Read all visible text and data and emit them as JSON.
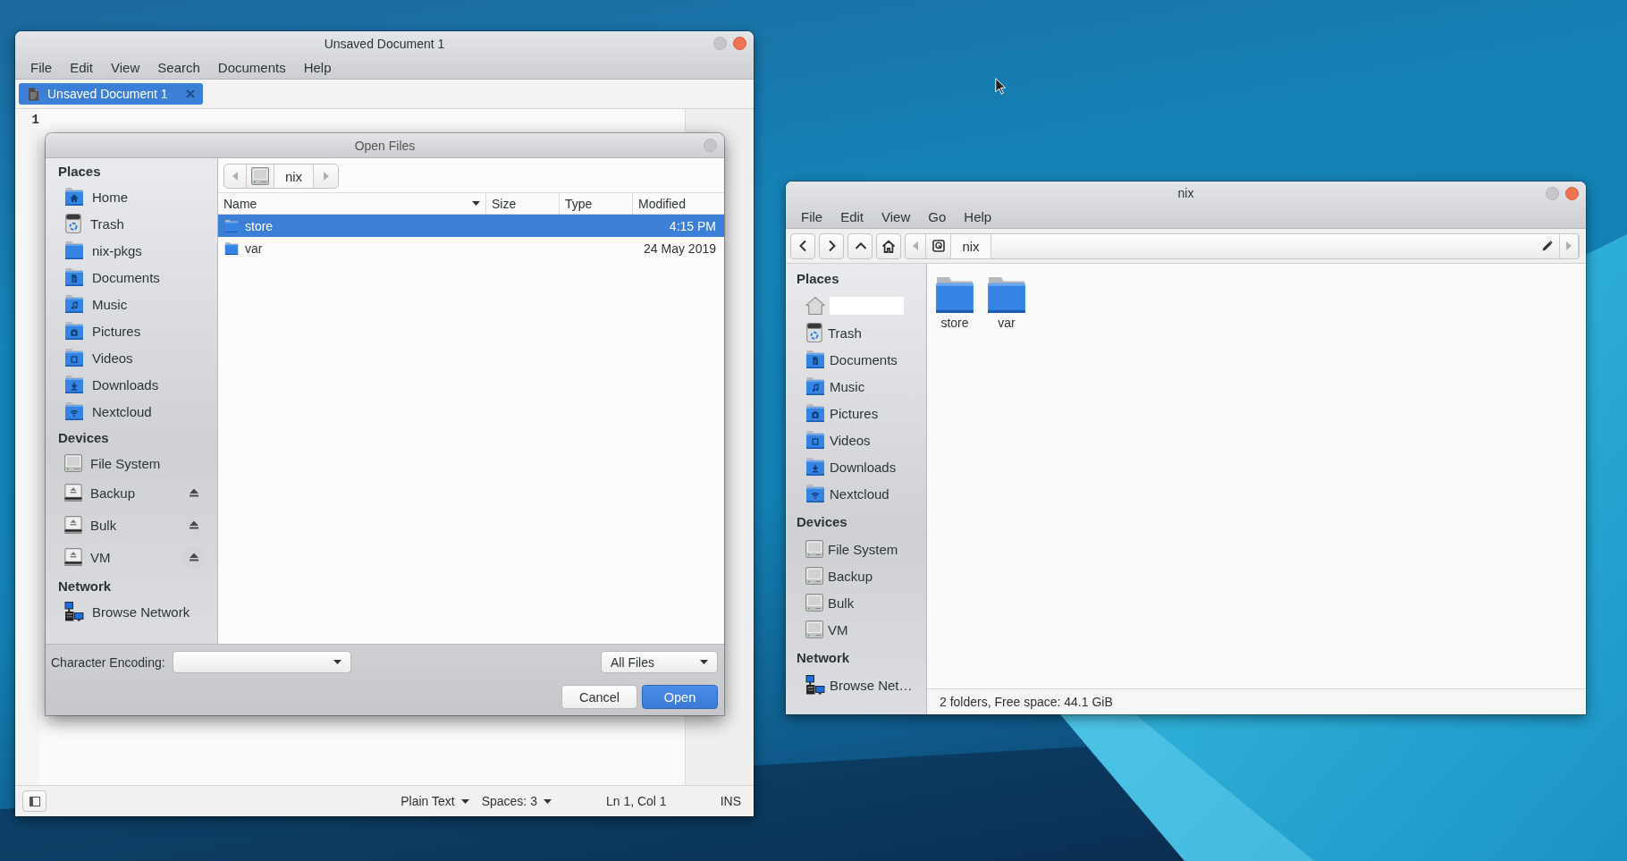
{
  "editor_window": {
    "title": "Unsaved Document 1",
    "menu": [
      "File",
      "Edit",
      "View",
      "Search",
      "Documents",
      "Help"
    ],
    "tabs": [
      {
        "label": "Unsaved Document 1",
        "selected": true
      }
    ],
    "line_numbers": [
      "1"
    ],
    "status_bar": [
      {
        "kind": "menu",
        "text": "Plain Text"
      },
      {
        "kind": "menu",
        "text": "Spaces: 3"
      },
      {
        "kind": "label",
        "text": "Ln 1, Col 1"
      },
      {
        "kind": "label",
        "text": "INS"
      }
    ]
  },
  "open_dialog": {
    "title": "Open Files",
    "sidebar": [
      {
        "heading": "Places",
        "items": [
          {
            "kind": "home",
            "label": "Home",
            "selected": false
          },
          {
            "kind": "trash",
            "label": "Trash",
            "selected": false
          },
          {
            "kind": "folder",
            "label": "nix-pkgs",
            "selected": false
          },
          {
            "kind": "documents",
            "label": "Documents",
            "selected": false
          },
          {
            "kind": "music",
            "label": "Music",
            "selected": false
          },
          {
            "kind": "pictures",
            "label": "Pictures",
            "selected": false
          },
          {
            "kind": "videos",
            "label": "Videos",
            "selected": false
          },
          {
            "kind": "downloads",
            "label": "Downloads",
            "selected": false
          },
          {
            "kind": "cloud",
            "label": "Nextcloud",
            "selected": false
          }
        ]
      },
      {
        "heading": "Devices",
        "items": [
          {
            "kind": "drive",
            "label": "File System",
            "selected": false
          },
          {
            "kind": "removable",
            "label": "Backup",
            "selected": false
          },
          {
            "kind": "removable",
            "label": "Bulk",
            "selected": false
          },
          {
            "kind": "removable",
            "label": "VM",
            "selected": false
          }
        ]
      },
      {
        "heading": "Network",
        "items": [
          {
            "kind": "network",
            "label": "Browse Network",
            "selected": false
          }
        ]
      }
    ],
    "location": "nix",
    "columns": [
      {
        "label": "Name",
        "sorted": true
      },
      {
        "label": "Size",
        "sorted": false
      },
      {
        "label": "Type",
        "sorted": false
      },
      {
        "label": "Modified",
        "sorted": false
      }
    ],
    "rows": [
      {
        "name": "store",
        "modified": "4:15 PM",
        "selected": true
      },
      {
        "name": "var",
        "modified": "24 May 2019",
        "selected": false
      }
    ],
    "encoding_label": "Character Encoding:",
    "filter": "All Files",
    "buttons": [
      {
        "kind": "cancel",
        "label": "Cancel"
      },
      {
        "kind": "confirm",
        "label": "Open"
      }
    ]
  },
  "file_manager": {
    "title": "nix",
    "menu": [
      "File",
      "Edit",
      "View",
      "Go",
      "Help"
    ],
    "location": "nix",
    "sidebar": [
      {
        "heading": "Places",
        "items": [
          {
            "kind": "house",
            "redacted": true,
            "selected": false
          },
          {
            "kind": "trash",
            "label": "Trash",
            "selected": false
          },
          {
            "kind": "documents",
            "label": "Documents",
            "selected": false
          },
          {
            "kind": "music",
            "label": "Music",
            "selected": false
          },
          {
            "kind": "pictures",
            "label": "Pictures",
            "selected": false
          },
          {
            "kind": "videos",
            "label": "Videos",
            "selected": false
          },
          {
            "kind": "downloads",
            "label": "Downloads",
            "selected": false
          },
          {
            "kind": "cloud",
            "label": "Nextcloud",
            "selected": false
          }
        ]
      },
      {
        "heading": "Devices",
        "items": [
          {
            "kind": "drive",
            "label": "File System",
            "selected": false
          },
          {
            "kind": "drive",
            "label": "Backup",
            "selected": false
          },
          {
            "kind": "drive",
            "label": "Bulk",
            "selected": false
          },
          {
            "kind": "drive",
            "label": "VM",
            "selected": false
          }
        ]
      },
      {
        "heading": "Network",
        "items": [
          {
            "kind": "network",
            "label": "Browse Net…",
            "selected": false
          }
        ]
      }
    ],
    "items": [
      {
        "name": "store",
        "selected": false
      },
      {
        "name": "var",
        "selected": false
      }
    ],
    "status": "2 folders, Free space: 44.1 GiB"
  }
}
